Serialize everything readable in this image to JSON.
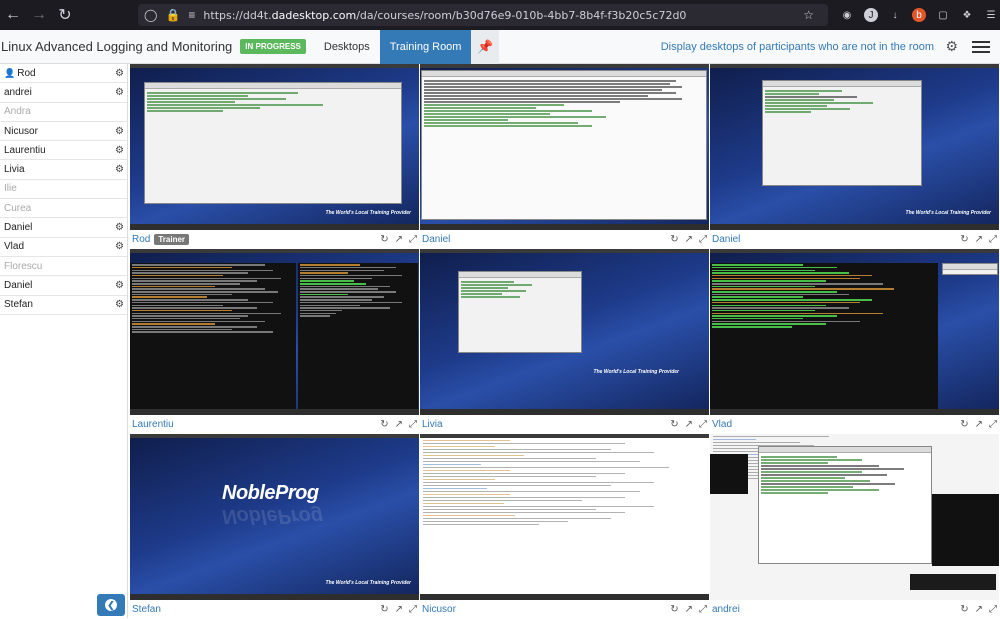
{
  "browser": {
    "url_prefix": "https://dd4t.",
    "url_domain": "dadesktop.com",
    "url_path": "/da/courses/room/b30d76e9-010b-4bb7-8b4f-f3b20c5c72d0"
  },
  "header": {
    "course_title": "Linux Advanced Logging and Monitoring",
    "status_badge": "IN PROGRESS",
    "tab_desktops": "Desktops",
    "tab_training_room": "Training Room",
    "display_link": "Display desktops of participants who are not in the room"
  },
  "sidebar": {
    "participants": [
      {
        "name": "Rod",
        "active": true,
        "trainer": true
      },
      {
        "name": "andrei",
        "active": true
      },
      {
        "name": "Andra",
        "active": false
      },
      {
        "name": "Nicusor",
        "active": true
      },
      {
        "name": "Laurentiu",
        "active": true
      },
      {
        "name": "Livia",
        "active": true
      },
      {
        "name": "Ilie",
        "active": false
      },
      {
        "name": "Curea",
        "active": false
      },
      {
        "name": "Daniel",
        "active": true
      },
      {
        "name": "Vlad",
        "active": true
      },
      {
        "name": "Florescu",
        "active": false
      },
      {
        "name": "Daniel",
        "active": true
      },
      {
        "name": "Stefan",
        "active": true
      }
    ]
  },
  "tiles": [
    {
      "name": "Rod",
      "badge": "Trainer"
    },
    {
      "name": "Daniel"
    },
    {
      "name": "Daniel"
    },
    {
      "name": "Laurentiu"
    },
    {
      "name": "Livia"
    },
    {
      "name": "Vlad"
    },
    {
      "name": "Stefan"
    },
    {
      "name": "Nicusor"
    },
    {
      "name": "andrei"
    }
  ],
  "desktop": {
    "logo": "NobleProg",
    "tagline": "The World's Local Training Provider"
  },
  "icons": {
    "back": "arrow-left-icon",
    "forward": "arrow-right-icon",
    "reload": "reload-icon",
    "refresh": "refresh-icon",
    "open": "external-link-icon",
    "fullscreen": "expand-icon",
    "settings": "gear-icon"
  },
  "colors": {
    "accent": "#337ab7",
    "badge_green": "#5cb85c",
    "trainer_badge": "#777777"
  }
}
